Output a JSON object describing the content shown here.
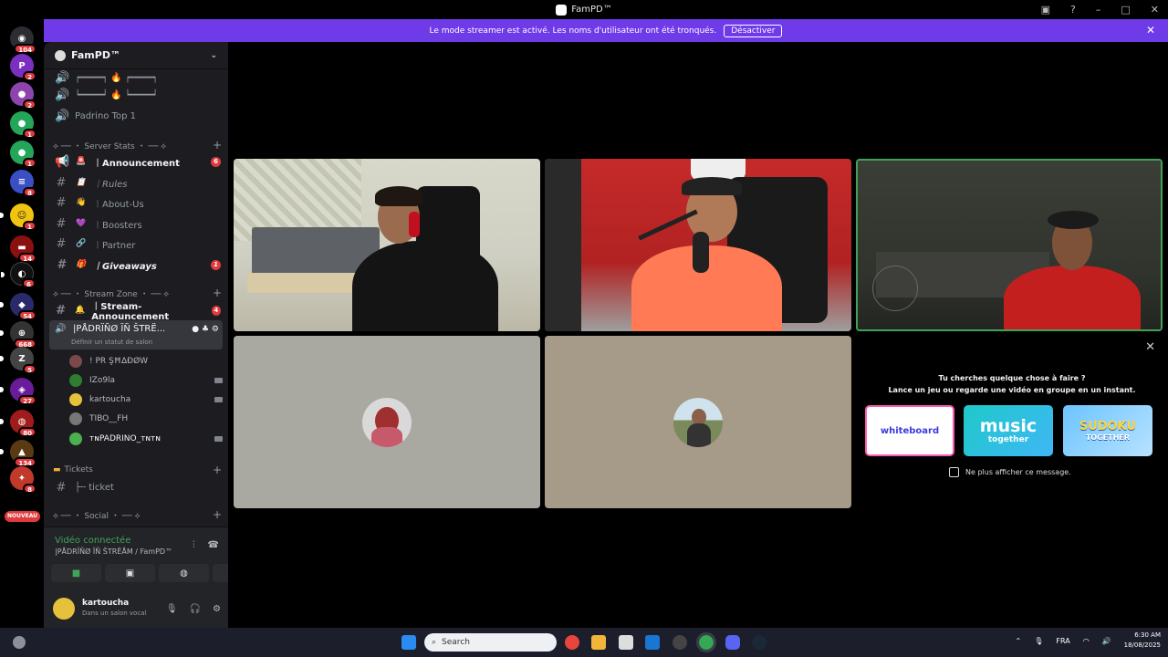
{
  "window": {
    "title": "FamPD™"
  },
  "banner": {
    "text": "Le mode streamer est activé. Les noms d'utilisateur ont été tronqués.",
    "button": "Désactiver"
  },
  "servers": [
    {
      "badge": "104"
    },
    {
      "badge": "2"
    },
    {
      "badge": "2"
    },
    {
      "badge": "1"
    },
    {
      "badge": "1"
    },
    {
      "badge": "8"
    },
    {
      "badge": "1"
    },
    {
      "badge": "14"
    },
    {
      "badge": "6"
    },
    {
      "badge": "54"
    },
    {
      "badge": "668"
    },
    {
      "badge": "5"
    },
    {
      "badge": "27"
    },
    {
      "badge": "80"
    },
    {
      "badge": "134"
    },
    {
      "badge": "8"
    }
  ],
  "servers_new_label": "NOUVEAU",
  "guild": {
    "name": "FamPD™"
  },
  "channels": {
    "padrino_top": "Padrino Top 1",
    "cat_server_stats": "⟡ ── ・ Server Stats ・ ── ⟡",
    "announcement": "︱Announcement",
    "announcement_badge": "6",
    "rules": "︱Rules",
    "about": "︱About-Us",
    "boosters": "︱Boosters",
    "partner": "︱Partner",
    "giveaways": "︱Giveaways",
    "giveaways_badge": "1",
    "cat_stream_zone": "⟡ ── ・ Stream Zone ・ ── ⟡",
    "stream_announcement": "︱Stream-Announcement",
    "stream_announcement_badge": "4",
    "voice_channel": "|PÅDRÏÑØ ÏÑ ŠTRË...",
    "voice_status": "Définir un statut de salon",
    "voice_users": [
      "! PR ŞĦΔĐØW",
      "IZo9la",
      "kartoucha",
      "TIBO__FH",
      "ᴛɴPADRINO_ᴛɴᴛɴ"
    ],
    "cat_tickets": "Tickets",
    "ticket": "├╌ ticket",
    "cat_social": "⟡ ── ・ Social ・ ── ⟡"
  },
  "voice_panel": {
    "status": "Vidéo connectée",
    "channel": "|PÅDRÏÑØ ÏÑ ŠTRËÅM / FamPD™"
  },
  "user": {
    "name": "kartoucha",
    "status": "Dans un salon vocal"
  },
  "activity": {
    "line1": "Tu cherches quelque chose à faire ?",
    "line2": "Lance un jeu ou regarde une vidéo en groupe en un instant.",
    "card1": "whiteboard",
    "card2_a": "music",
    "card2_b": "together",
    "card3_a": "SUDOKU",
    "card3_b": "TOGETHER",
    "dont_show": "Ne plus afficher ce message."
  },
  "taskbar": {
    "search": "Search",
    "lang": "FRA",
    "time": "6:30 AM",
    "date": "18/08/2025"
  },
  "colors": {
    "blurple": "#6f3ae8",
    "green": "#43a25a",
    "red": "#e03a3e"
  }
}
